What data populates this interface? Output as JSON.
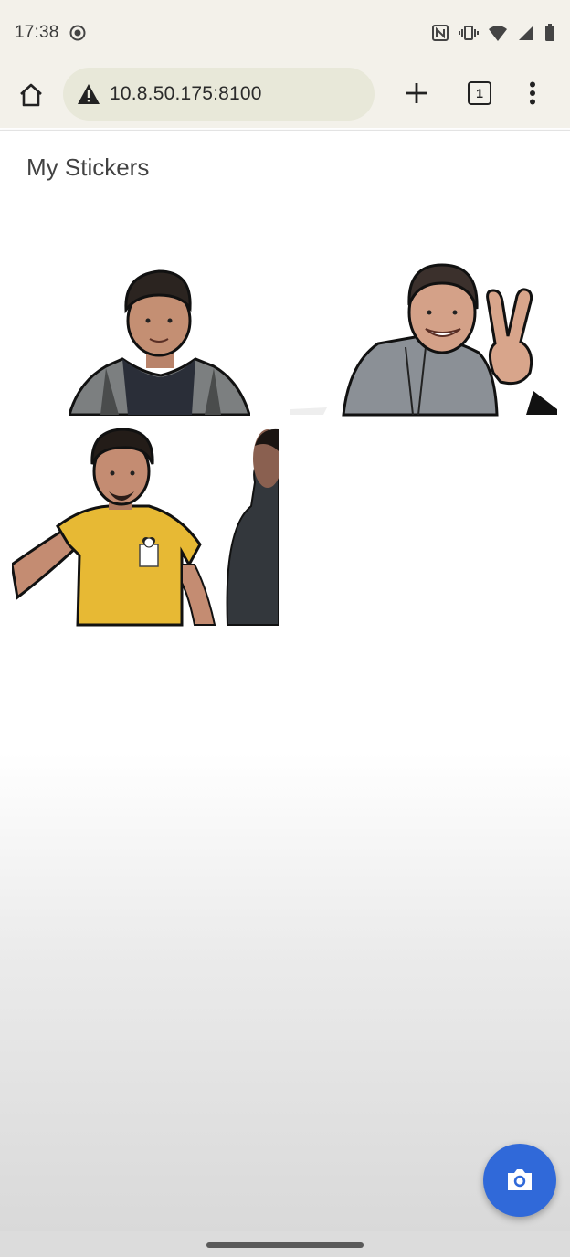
{
  "status_bar": {
    "time": "17:38",
    "icons": [
      "screen-record-icon",
      "nfc-icon",
      "vibrate-icon",
      "wifi-icon",
      "signal-icon",
      "battery-icon"
    ]
  },
  "browser": {
    "url": "10.8.50.175:8100",
    "security_icon": "warning-icon",
    "tab_count": "1",
    "actions": [
      "home-icon",
      "new-tab-icon",
      "tab-switcher",
      "overflow-menu-icon"
    ]
  },
  "app": {
    "title": "My Stickers"
  },
  "stickers": [
    {
      "name": "sticker-man-dark-jacket"
    },
    {
      "name": "sticker-man-peace-sign"
    },
    {
      "name": "sticker-man-yellow-tshirt"
    }
  ],
  "fab": {
    "icon": "camera-icon",
    "color": "#3069d9"
  }
}
